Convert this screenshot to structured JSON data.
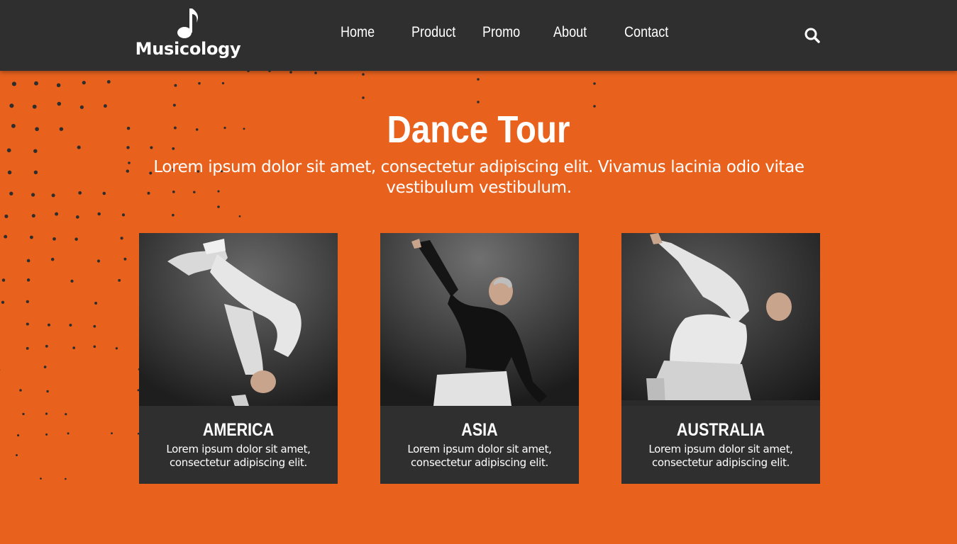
{
  "brand": {
    "name": "Musicology",
    "logo_icon": "music-note-icon"
  },
  "nav": {
    "items": [
      {
        "label": "Home"
      },
      {
        "label": "Product"
      },
      {
        "label": "Promo"
      },
      {
        "label": "About"
      },
      {
        "label": "Contact"
      }
    ],
    "search_icon": "search-icon"
  },
  "hero": {
    "title": "Dance Tour",
    "subtitle": "Lorem ipsum dolor sit amet, consectetur adipiscing elit. Vivamus lacinia odio vitae vestibulum vestibulum."
  },
  "cards": [
    {
      "title": "AMERICA",
      "text": "Lorem ipsum dolor sit amet, consectetur adipiscing elit."
    },
    {
      "title": "ASIA",
      "text": "Lorem ipsum dolor sit amet, consectetur adipiscing elit."
    },
    {
      "title": "AUSTRALIA",
      "text": "Lorem ipsum dolor sit amet, consectetur adipiscing elit."
    }
  ],
  "colors": {
    "background": "#e8621e",
    "navbar": "#2f2f2f",
    "card": "#2f2f2f",
    "text": "#ffffff"
  }
}
